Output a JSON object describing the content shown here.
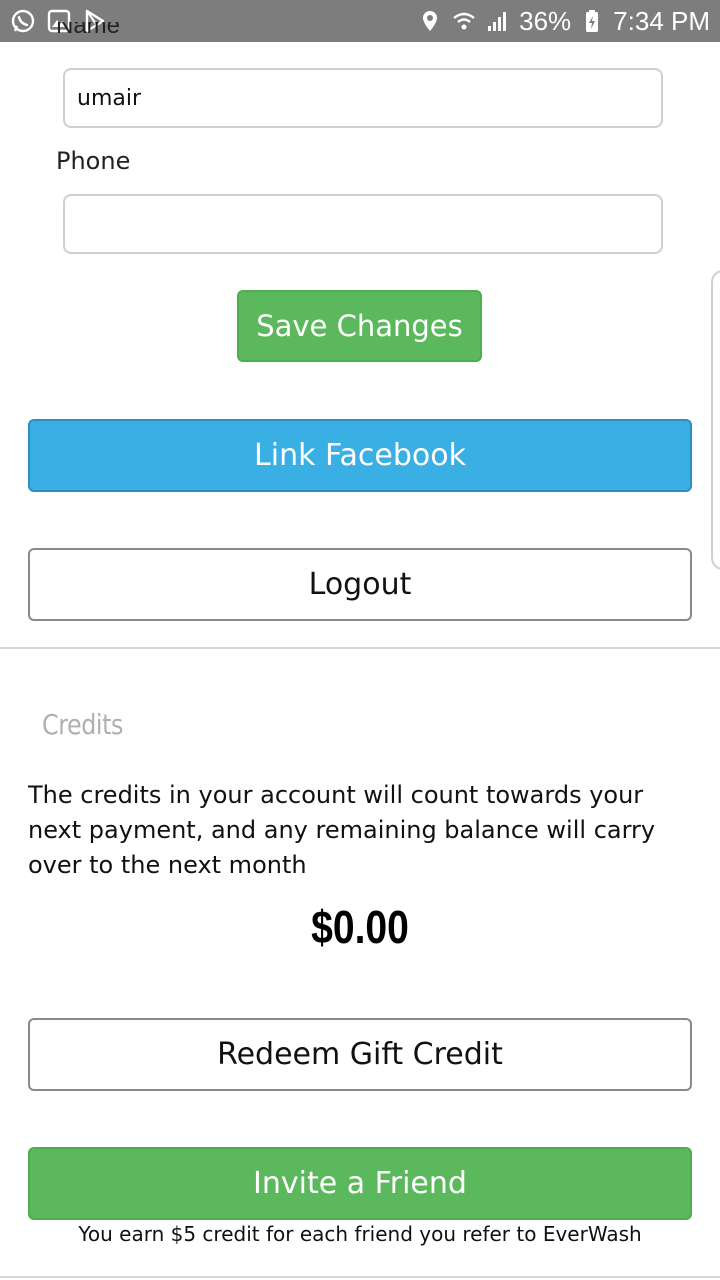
{
  "status_bar": {
    "battery": "36%",
    "time": "7:34 PM"
  },
  "profile": {
    "name_label": "Name",
    "name_value": "umair",
    "phone_label": "Phone",
    "phone_value": "",
    "save_label": "Save Changes"
  },
  "account": {
    "link_facebook_label": "Link Facebook",
    "logout_label": "Logout"
  },
  "credits": {
    "heading": "Credits",
    "description": "The credits in your account will count towards your next payment, and any remaining balance will carry over to the next month",
    "amount": "$0.00",
    "redeem_label": "Redeem Gift Credit",
    "invite_label": "Invite a Friend",
    "referral_note": "You earn $5 credit for each friend you refer to EverWash"
  },
  "colors": {
    "status_bar": "#7d7d7d",
    "primary_green": "#5cb85c",
    "facebook_blue": "#3aafe3",
    "muted_heading": "#b0b0b0"
  }
}
